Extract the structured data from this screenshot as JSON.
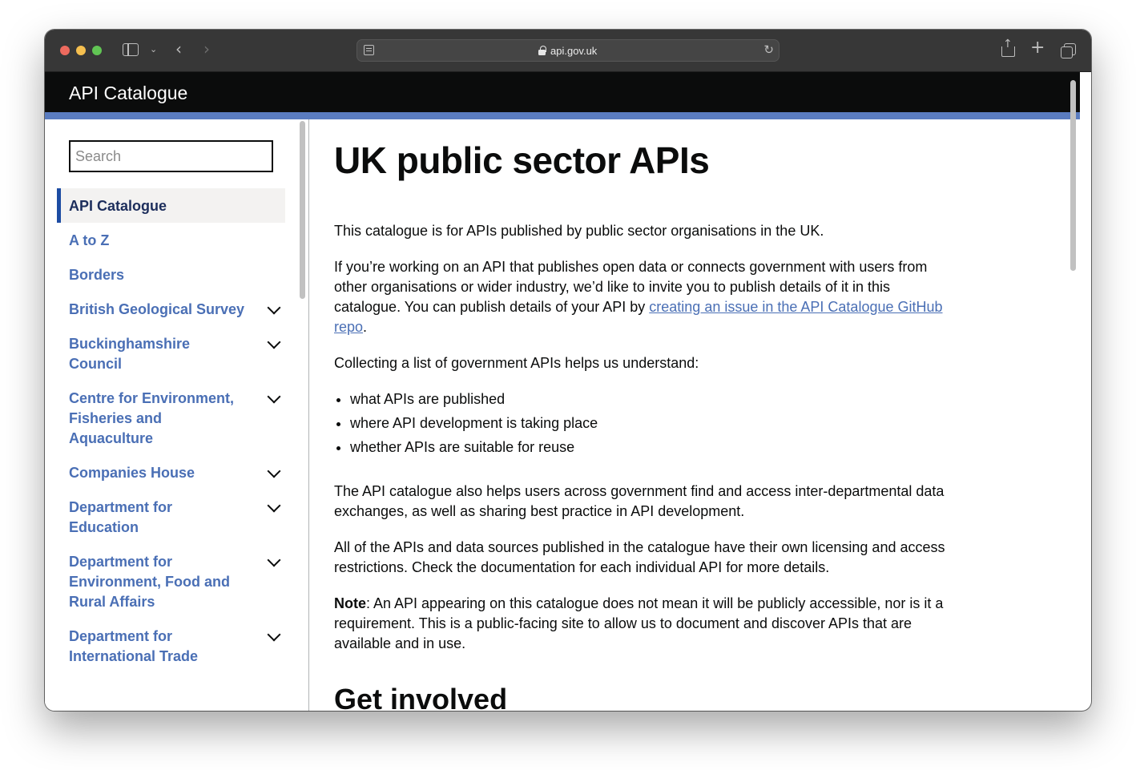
{
  "browser": {
    "url": "api.gov.uk"
  },
  "header": {
    "site_title": "API Catalogue"
  },
  "sidebar": {
    "search_placeholder": "Search",
    "items": [
      {
        "label": "API Catalogue",
        "active": true,
        "expandable": false
      },
      {
        "label": "A to Z",
        "active": false,
        "expandable": false
      },
      {
        "label": "Borders",
        "active": false,
        "expandable": false
      },
      {
        "label": "British Geological Survey",
        "active": false,
        "expandable": true
      },
      {
        "label": "Buckinghamshire Council",
        "active": false,
        "expandable": true
      },
      {
        "label": "Centre for Environment, Fisheries and Aquaculture",
        "active": false,
        "expandable": true
      },
      {
        "label": "Companies House",
        "active": false,
        "expandable": true
      },
      {
        "label": "Department for Education",
        "active": false,
        "expandable": true
      },
      {
        "label": "Department for Environment, Food and Rural Affairs",
        "active": false,
        "expandable": true
      },
      {
        "label": "Department for International Trade",
        "active": false,
        "expandable": true
      }
    ]
  },
  "main": {
    "title": "UK public sector APIs",
    "intro": "This catalogue is for APIs published by public sector organisations in the UK.",
    "invite_text": "If you’re working on an API that publishes open data or connects government with users from other organisations or wider industry, we’d like to invite you to publish details of it in this catalogue. You can publish details of your API by ",
    "invite_link": "creating an issue in the API Catalogue GitHub repo",
    "invite_end": ".",
    "collecting": "Collecting a list of government APIs helps us understand:",
    "bullets": [
      "what APIs are published",
      "where API development is taking place",
      "whether APIs are suitable for reuse"
    ],
    "also_helps": "The API catalogue also helps users across government find and access inter-departmental data exchanges, as well as sharing best practice in API development.",
    "licensing": "All of the APIs and data sources published in the catalogue have their own licensing and access restrictions. Check the documentation for each individual API for more details.",
    "note_label": "Note",
    "note_text": ": An API appearing on this catalogue does not mean it will be publicly accessible, nor is it a requirement. This is a public-facing site to allow us to document and discover APIs that are available and in use.",
    "next_heading": "Get involved"
  },
  "colors": {
    "header_bg": "#0b0c0c",
    "accent_bar": "#5a7cc0",
    "link": "#4a6fb5",
    "active_border": "#1d4ca3"
  }
}
